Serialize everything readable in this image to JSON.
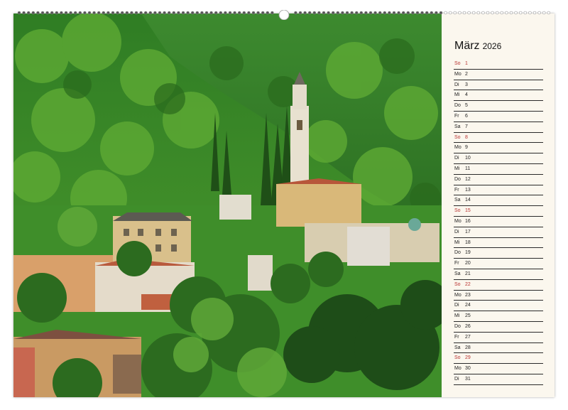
{
  "calendar": {
    "month": "März",
    "year": "2026",
    "days": [
      {
        "weekday": "So",
        "day": "1",
        "sunday": true
      },
      {
        "weekday": "Mo",
        "day": "2",
        "sunday": false
      },
      {
        "weekday": "Di",
        "day": "3",
        "sunday": false
      },
      {
        "weekday": "Mi",
        "day": "4",
        "sunday": false
      },
      {
        "weekday": "Do",
        "day": "5",
        "sunday": false
      },
      {
        "weekday": "Fr",
        "day": "6",
        "sunday": false
      },
      {
        "weekday": "Sa",
        "day": "7",
        "sunday": false
      },
      {
        "weekday": "So",
        "day": "8",
        "sunday": true
      },
      {
        "weekday": "Mo",
        "day": "9",
        "sunday": false
      },
      {
        "weekday": "Di",
        "day": "10",
        "sunday": false
      },
      {
        "weekday": "Mi",
        "day": "11",
        "sunday": false
      },
      {
        "weekday": "Do",
        "day": "12",
        "sunday": false
      },
      {
        "weekday": "Fr",
        "day": "13",
        "sunday": false
      },
      {
        "weekday": "Sa",
        "day": "14",
        "sunday": false
      },
      {
        "weekday": "So",
        "day": "15",
        "sunday": true
      },
      {
        "weekday": "Mo",
        "day": "16",
        "sunday": false
      },
      {
        "weekday": "Di",
        "day": "17",
        "sunday": false
      },
      {
        "weekday": "Mi",
        "day": "18",
        "sunday": false
      },
      {
        "weekday": "Do",
        "day": "19",
        "sunday": false
      },
      {
        "weekday": "Fr",
        "day": "20",
        "sunday": false
      },
      {
        "weekday": "Sa",
        "day": "21",
        "sunday": false
      },
      {
        "weekday": "So",
        "day": "22",
        "sunday": true
      },
      {
        "weekday": "Mo",
        "day": "23",
        "sunday": false
      },
      {
        "weekday": "Di",
        "day": "24",
        "sunday": false
      },
      {
        "weekday": "Mi",
        "day": "25",
        "sunday": false
      },
      {
        "weekday": "Do",
        "day": "26",
        "sunday": false
      },
      {
        "weekday": "Fr",
        "day": "27",
        "sunday": false
      },
      {
        "weekday": "Sa",
        "day": "28",
        "sunday": false
      },
      {
        "weekday": "So",
        "day": "29",
        "sunday": true
      },
      {
        "weekday": "Mo",
        "day": "30",
        "sunday": false
      },
      {
        "weekday": "Di",
        "day": "31",
        "sunday": false
      }
    ]
  },
  "colors": {
    "sunday_text": "#b8312f",
    "panel_background": "#fbf7ee",
    "rule_line": "#2a2a2a"
  }
}
